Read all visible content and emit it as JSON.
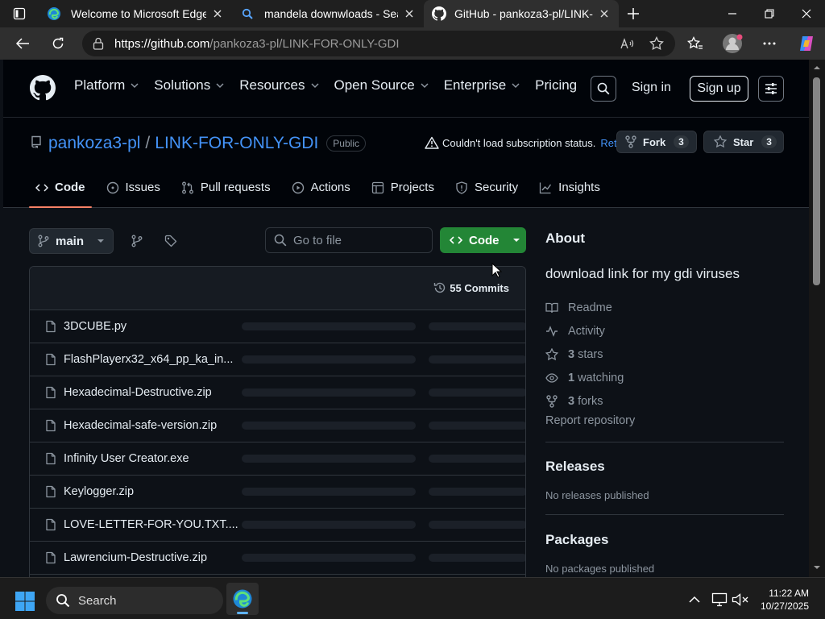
{
  "browser": {
    "tabs": [
      {
        "title": "Welcome to Microsoft Edge",
        "active": false
      },
      {
        "title": "mandela downwloads - Search",
        "active": false
      },
      {
        "title": "GitHub - pankoza3-pl/LINK-FOR-",
        "active": true
      }
    ],
    "url_host": "https://github.com",
    "url_path": "/pankoza3-pl/LINK-FOR-ONLY-GDI"
  },
  "gh_nav": {
    "menu": [
      "Platform",
      "Solutions",
      "Resources",
      "Open Source",
      "Enterprise",
      "Pricing"
    ],
    "sign_in": "Sign in",
    "sign_up": "Sign up"
  },
  "repo": {
    "owner": "pankoza3-pl",
    "separator": "/",
    "name": "LINK-FOR-ONLY-GDI",
    "visibility": "Public",
    "warning": "Couldn't load subscription status.",
    "retry": "Retry",
    "fork_label": "Fork",
    "fork_count": "3",
    "star_label": "Star",
    "star_count": "3",
    "tabs": [
      "Code",
      "Issues",
      "Pull requests",
      "Actions",
      "Projects",
      "Security",
      "Insights"
    ]
  },
  "files": {
    "branch": "main",
    "goto_placeholder": "Go to file",
    "code_button": "Code",
    "commits": "55 Commits",
    "list": [
      "3DCUBE.py",
      "FlashPlayerx32_x64_pp_ka_in...",
      "Hexadecimal-Destructive.zip",
      "Hexadecimal-safe-version.zip",
      "Infinity User Creator.exe",
      "Keylogger.zip",
      "LOVE-LETTER-FOR-YOU.TXT....",
      "Lawrencium-Destructive.zip"
    ]
  },
  "about": {
    "heading": "About",
    "description": "download link for my gdi viruses",
    "readme": "Readme",
    "activity": "Activity",
    "stars_num": "3",
    "stars_word": "stars",
    "watching_num": "1",
    "watching_word": "watching",
    "forks_num": "3",
    "forks_word": "forks",
    "report": "Report repository",
    "releases_heading": "Releases",
    "releases_text": "No releases published",
    "packages_heading": "Packages",
    "packages_text": "No packages published"
  },
  "taskbar": {
    "search": "Search",
    "time": "11:22 AM",
    "date": "10/27/2025"
  },
  "colors": {
    "accent_link": "#4493f8",
    "code_button": "#238636",
    "tab_underline": "#f78166",
    "page_bg": "#0d1117"
  }
}
